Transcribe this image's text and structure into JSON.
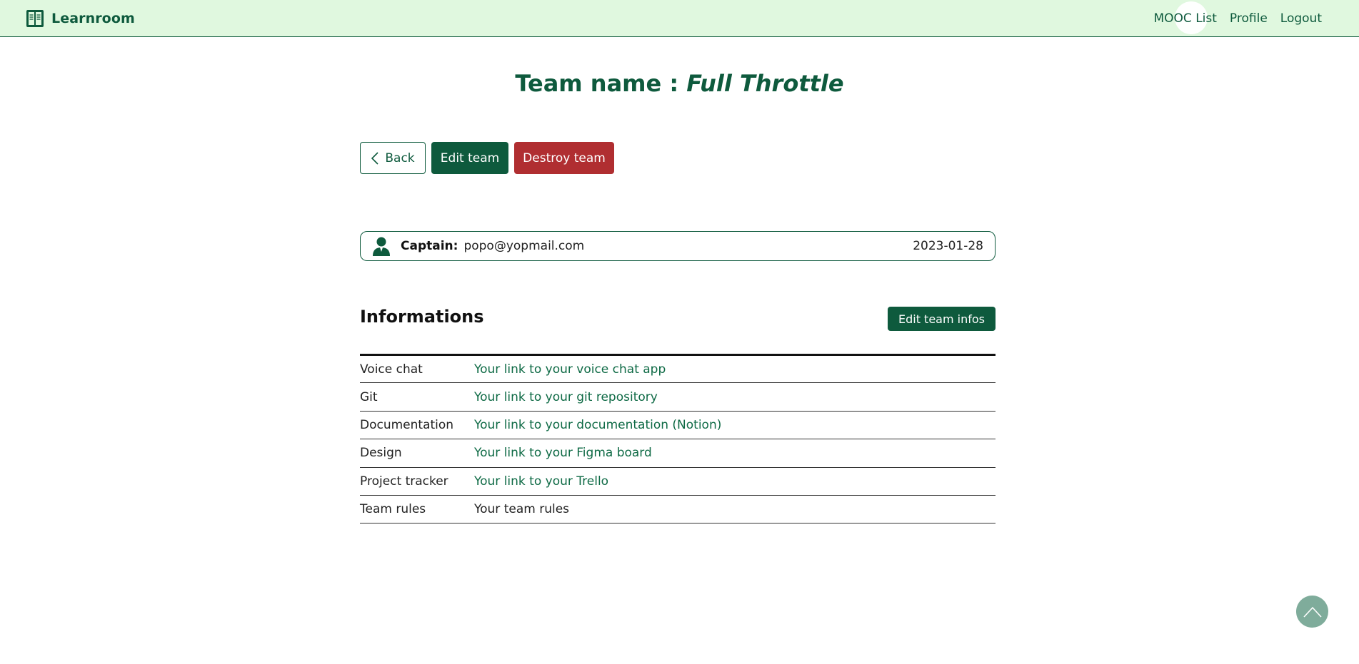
{
  "navbar": {
    "brand": "Learnroom",
    "links": [
      {
        "label": "MOOC List"
      },
      {
        "label": "Profile"
      },
      {
        "label": "Logout"
      }
    ]
  },
  "page": {
    "title_prefix": "Team name : ",
    "team_name": "Full Throttle"
  },
  "actions": {
    "back_label": "Back",
    "edit_label": "Edit team",
    "destroy_label": "Destroy team"
  },
  "captain": {
    "label": "Captain:",
    "email": "popo@yopmail.com",
    "date": "2023-01-28"
  },
  "informations": {
    "heading": "Informations",
    "edit_label": "Edit team infos",
    "rows": [
      {
        "key": "Voice chat",
        "value": "Your link to your voice chat app",
        "is_link": true
      },
      {
        "key": "Git",
        "value": "Your link to your git repository",
        "is_link": true
      },
      {
        "key": "Documentation",
        "value": "Your link to your documentation (Notion)",
        "is_link": true
      },
      {
        "key": "Design",
        "value": "Your link to your Figma board",
        "is_link": true
      },
      {
        "key": "Project tracker",
        "value": "Your link to your Trello",
        "is_link": true
      },
      {
        "key": "Team rules",
        "value": "Your team rules",
        "is_link": false
      }
    ]
  },
  "colors": {
    "brand_green": "#0e5a3d",
    "navbar_bg": "#e0f8df",
    "danger_red": "#b02e31",
    "scroll_top_bg": "#7fac9b"
  },
  "icons": {
    "brand": "book-icon",
    "back": "chevron-left-icon",
    "captain": "user-icon",
    "scroll_top": "chevron-up-icon"
  }
}
